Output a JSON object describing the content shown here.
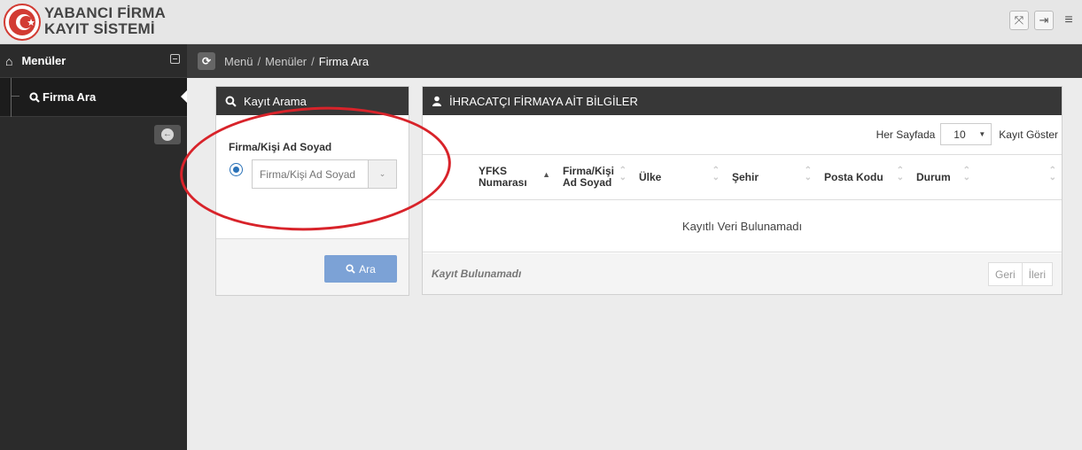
{
  "app": {
    "brand_line1": "YABANCI FİRMA",
    "brand_line2": "KAYIT SİSTEMİ"
  },
  "top_actions": [
    {
      "icon": "fullscreen-icon",
      "glyph": "⤧"
    },
    {
      "icon": "logout-icon",
      "glyph": "⇥"
    },
    {
      "icon": "hamburger-menu-icon",
      "glyph": "≡"
    }
  ],
  "sidebar": {
    "header_label": "Menüler",
    "items": [
      {
        "label": "Firma Ara",
        "icon": "search-icon"
      }
    ]
  },
  "breadcrumb": {
    "items": [
      "Menü",
      "Menüler",
      "Firma Ara"
    ],
    "separator": "/"
  },
  "search_panel": {
    "title": "Kayıt Arama",
    "field_label": "Firma/Kişi Ad Soyad",
    "input_placeholder": "Firma/Kişi Ad Soyad",
    "input_value": "",
    "radio_selected": true,
    "search_button": "Ara"
  },
  "info_panel": {
    "title": "İHRACATÇI FİRMAYA AİT BİLGİLER",
    "per_page_label": "Her Sayfada",
    "per_page_value": "10",
    "show_records_label": "Kayıt Göster",
    "columns": [
      "YFKS Numarası",
      "Firma/Kişi Ad Soyad",
      "Ülke",
      "Şehir",
      "Posta Kodu",
      "Durum",
      ""
    ],
    "empty_message": "Kayıtlı Veri Bulunamadı",
    "footer_status": "Kayıt Bulunamadı",
    "pager": {
      "prev": "Geri",
      "next": "İleri"
    }
  },
  "colors": {
    "top_bar": "#e6e6e6",
    "sidebar": "#2b2b2b",
    "panel_header": "#373737",
    "primary_button": "#7ca2d6",
    "annotation": "#d8232a"
  }
}
